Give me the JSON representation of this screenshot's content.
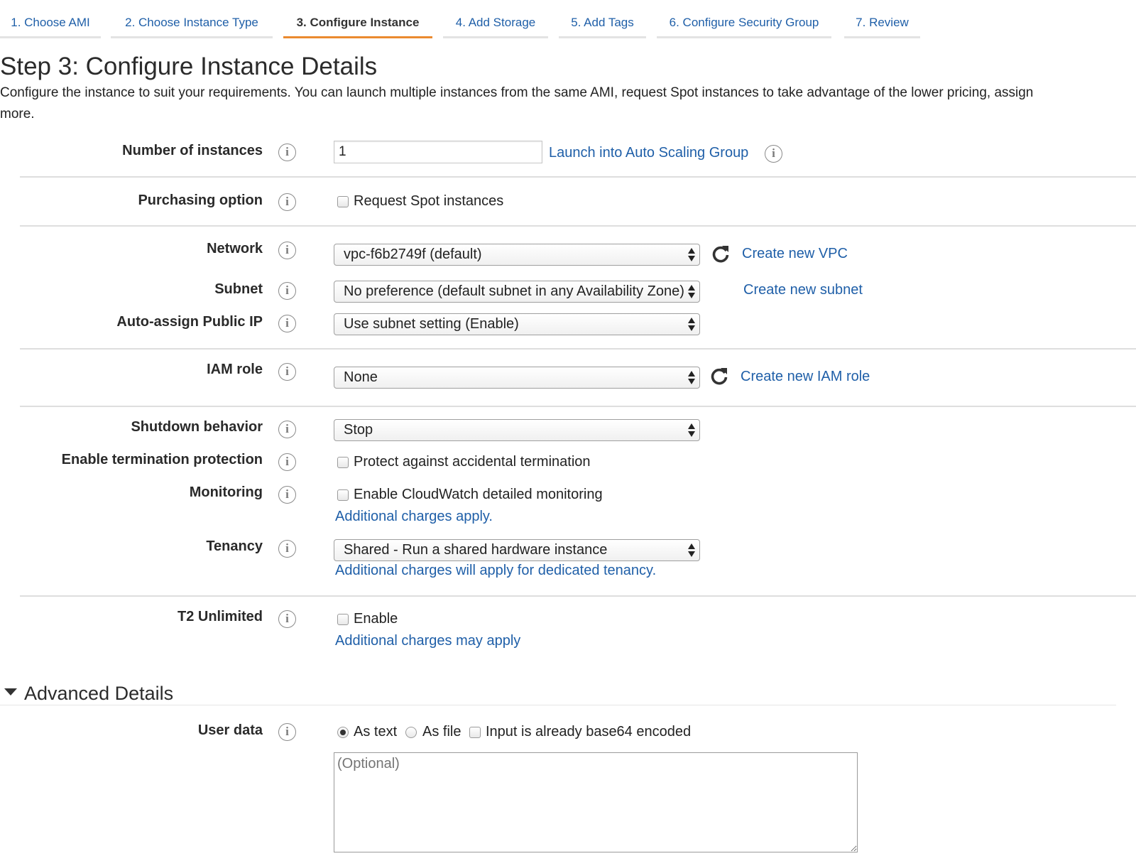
{
  "tabs": [
    {
      "label": "1. Choose AMI"
    },
    {
      "label": "2. Choose Instance Type"
    },
    {
      "label": "3. Configure Instance",
      "active": true
    },
    {
      "label": "4. Add Storage"
    },
    {
      "label": "5. Add Tags"
    },
    {
      "label": "6. Configure Security Group"
    },
    {
      "label": "7. Review"
    }
  ],
  "page": {
    "title": "Step 3: Configure Instance Details",
    "description": "Configure the instance to suit your requirements. You can launch multiple instances from the same AMI, request Spot instances to take advantage of the lower pricing, assign",
    "description_cont": "more."
  },
  "instances": {
    "label": "Number of instances",
    "value": "1",
    "link": "Launch into Auto Scaling Group"
  },
  "purchasing": {
    "label": "Purchasing option",
    "checkbox_label": "Request Spot instances",
    "checked": false
  },
  "network": {
    "label": "Network",
    "value": "vpc-f6b2749f (default)",
    "link": "Create new VPC"
  },
  "subnet": {
    "label": "Subnet",
    "value": "No preference (default subnet in any Availability Zone)",
    "link": "Create new subnet"
  },
  "public_ip": {
    "label": "Auto-assign Public IP",
    "value": "Use subnet setting (Enable)"
  },
  "iam": {
    "label": "IAM role",
    "value": "None",
    "link": "Create new IAM role"
  },
  "shutdown": {
    "label": "Shutdown behavior",
    "value": "Stop"
  },
  "termination": {
    "label": "Enable termination protection",
    "checkbox_label": "Protect against accidental termination",
    "checked": false
  },
  "monitoring": {
    "label": "Monitoring",
    "checkbox_label": "Enable CloudWatch detailed monitoring",
    "checked": false,
    "link": "Additional charges apply."
  },
  "tenancy": {
    "label": "Tenancy",
    "value": "Shared - Run a shared hardware instance",
    "link": "Additional charges will apply for dedicated tenancy."
  },
  "t2": {
    "label": "T2 Unlimited",
    "checkbox_label": "Enable",
    "checked": false,
    "link": "Additional charges may apply"
  },
  "advanced": {
    "title": "Advanced Details",
    "expanded": true
  },
  "user_data": {
    "label": "User data",
    "option_text": "As text",
    "option_file": "As file",
    "base64_label": "Input is already base64 encoded",
    "selected": "As text",
    "placeholder": "(Optional)"
  },
  "icons": {
    "info": "info-icon",
    "refresh": "refresh-icon",
    "expand": "caret-down-icon"
  },
  "colors": {
    "link": "#1f5fa8",
    "active_tab_underline": "#eb8a2f",
    "text": "#222222"
  }
}
